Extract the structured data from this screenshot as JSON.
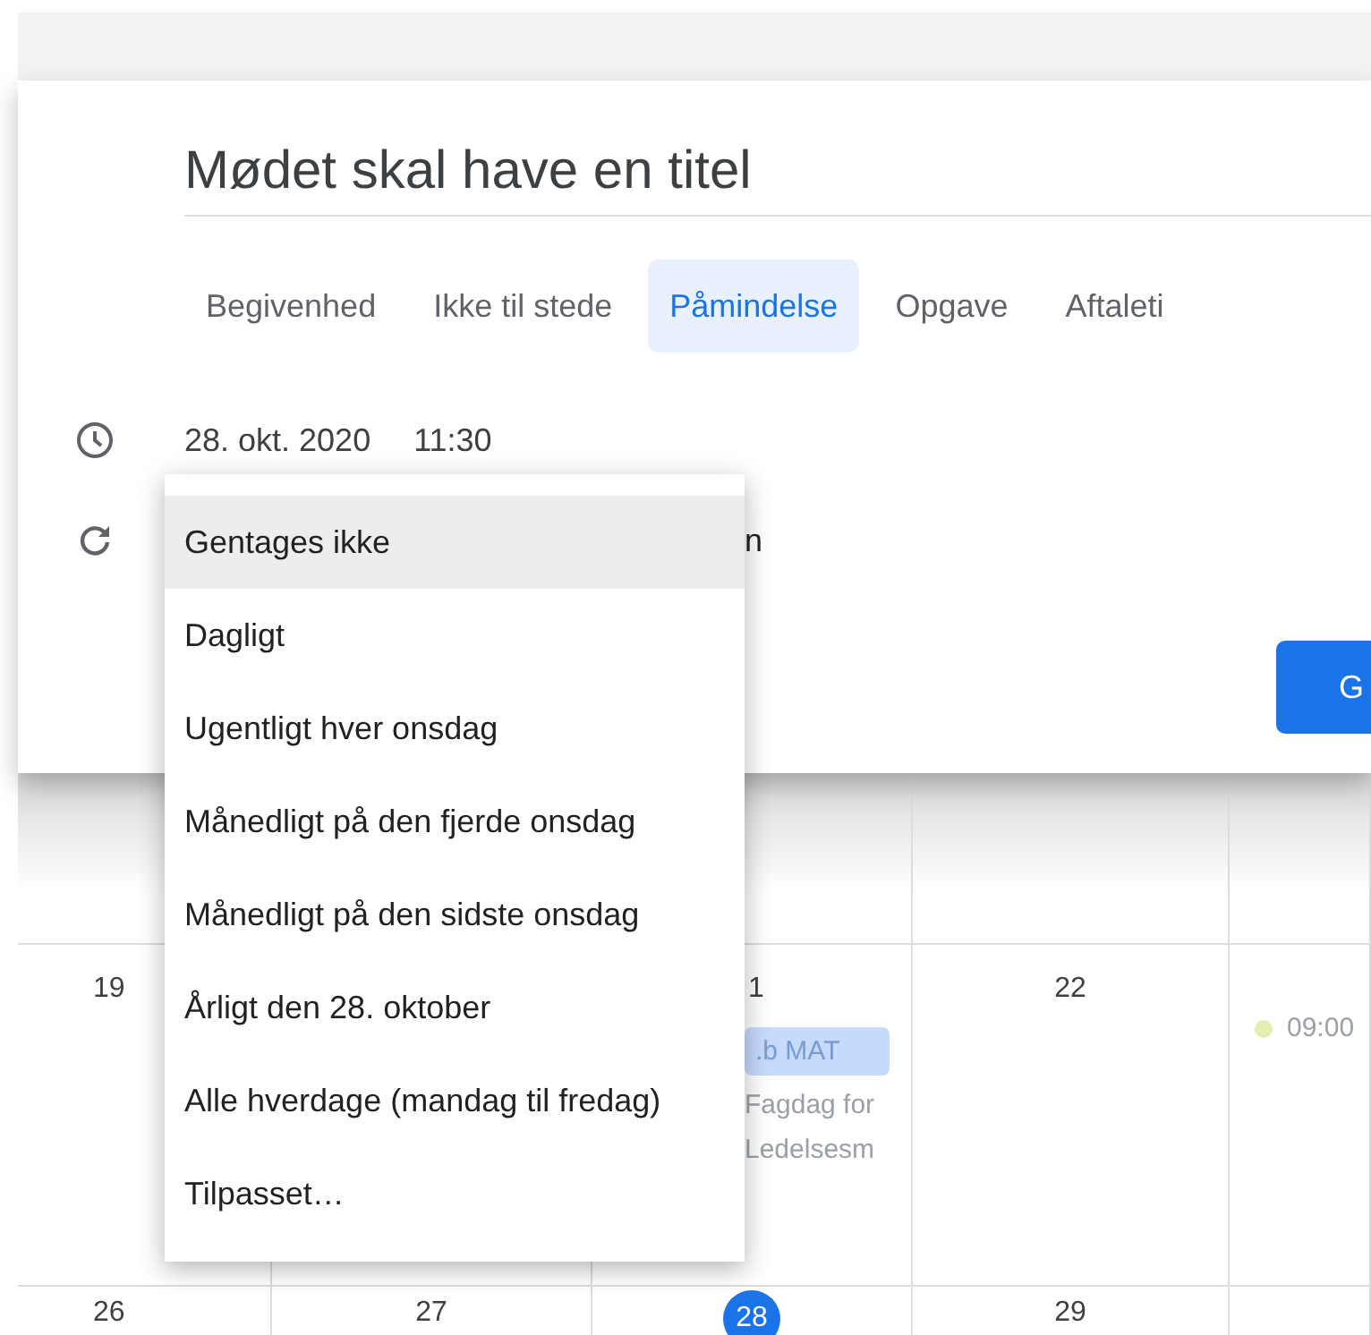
{
  "title": "Mødet skal have en titel",
  "tabs": [
    {
      "label": "Begivenhed",
      "selected": false
    },
    {
      "label": "Ikke til stede",
      "selected": false
    },
    {
      "label": "Påmindelse",
      "selected": true
    },
    {
      "label": "Opgave",
      "selected": false
    },
    {
      "label": "Aftaleti",
      "selected": false
    }
  ],
  "date": "28. okt. 2020",
  "time": "11:30",
  "repeat_value": "n",
  "save_button": "G",
  "calendar": {
    "rows": [
      {
        "cells": [
          {
            "day": "19"
          },
          {},
          {
            "day": "1",
            "events": [
              {
                "kind": "chip",
                "text": ".b MAT"
              },
              {
                "kind": "text",
                "text": "Fagdag for"
              },
              {
                "kind": "text",
                "text": "Ledelsesm"
              }
            ]
          },
          {
            "day": "22"
          },
          {
            "events": [
              {
                "kind": "dot",
                "text": "09:00",
                "color": "#e6edb0"
              }
            ]
          }
        ]
      },
      {
        "cells": [
          {
            "day": "26",
            "today": false
          },
          {
            "day": "27",
            "today": false
          },
          {
            "day": "28",
            "today": true
          },
          {
            "day": "29",
            "today": false
          },
          {}
        ]
      }
    ]
  },
  "repeat_menu": [
    {
      "label": "Gentages ikke",
      "selected": true
    },
    {
      "label": "Dagligt",
      "selected": false
    },
    {
      "label": "Ugentligt hver onsdag",
      "selected": false
    },
    {
      "label": "Månedligt på den fjerde onsdag",
      "selected": false
    },
    {
      "label": "Månedligt på den sidste onsdag",
      "selected": false
    },
    {
      "label": "Årligt den 28. oktober",
      "selected": false
    },
    {
      "label": "Alle hverdage (mandag til fredag)",
      "selected": false
    },
    {
      "label": "Tilpasset…",
      "selected": false
    }
  ]
}
